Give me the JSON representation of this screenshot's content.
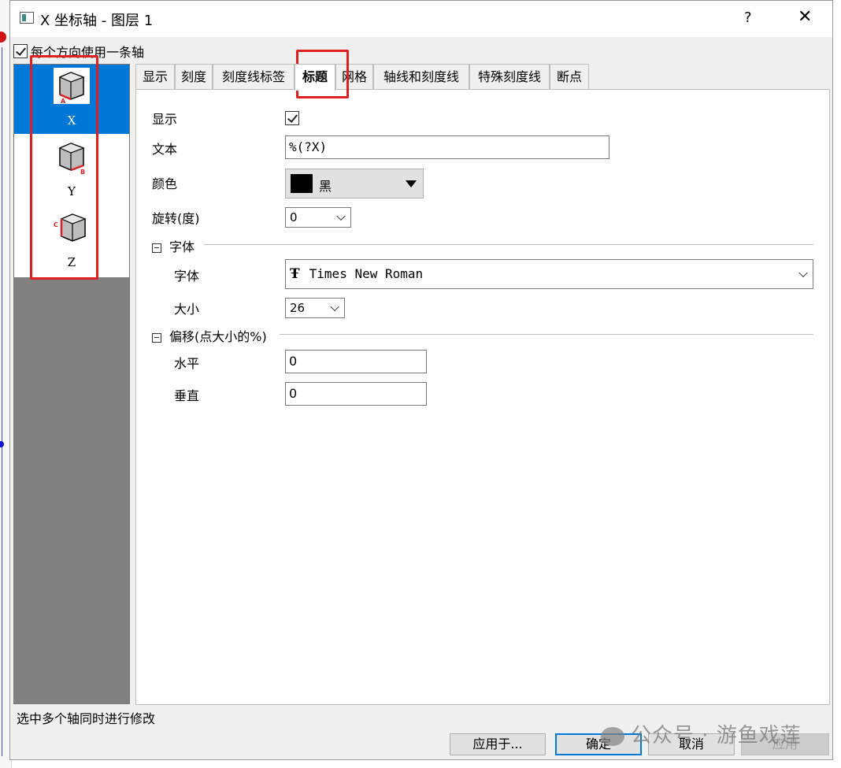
{
  "window": {
    "title": "X 坐标轴 - 图层 1",
    "help": "?",
    "close": "✕"
  },
  "top_checkbox": {
    "label": "每个方向使用一条轴",
    "checked": true
  },
  "axes": [
    {
      "label": "X",
      "icon": "cube-axis-a-icon",
      "selected": true
    },
    {
      "label": "Y",
      "icon": "cube-axis-b-icon",
      "selected": false
    },
    {
      "label": "Z",
      "icon": "cube-axis-c-icon",
      "selected": false
    }
  ],
  "tabs": [
    {
      "label": "显示"
    },
    {
      "label": "刻度"
    },
    {
      "label": "刻度线标签"
    },
    {
      "label": "标题",
      "active": true
    },
    {
      "label": "网格"
    },
    {
      "label": "轴线和刻度线"
    },
    {
      "label": "特殊刻度线"
    },
    {
      "label": "断点"
    }
  ],
  "form": {
    "show_label": "显示",
    "show_checked": true,
    "text_label": "文本",
    "text_value": "%(?X)",
    "color_label": "颜色",
    "color_name": "黑",
    "color_value": "#000000",
    "rotate_label": "旋转(度)",
    "rotate_value": "0",
    "font_section": "字体",
    "font_label": "字体",
    "font_value": "Times New Roman",
    "size_label": "大小",
    "size_value": "26",
    "offset_section": "偏移(点大小的%)",
    "horizontal_label": "水平",
    "horizontal_value": "0",
    "vertical_label": "垂直",
    "vertical_value": "0"
  },
  "status": "选中多个轴同时进行修改",
  "buttons": {
    "apply_to": "应用于...",
    "ok": "确定",
    "cancel": "取消",
    "apply": "应用"
  },
  "watermark": "公众号 · 游鱼戏莲",
  "highlight_color": "#e02020",
  "selection_color": "#0078d7"
}
